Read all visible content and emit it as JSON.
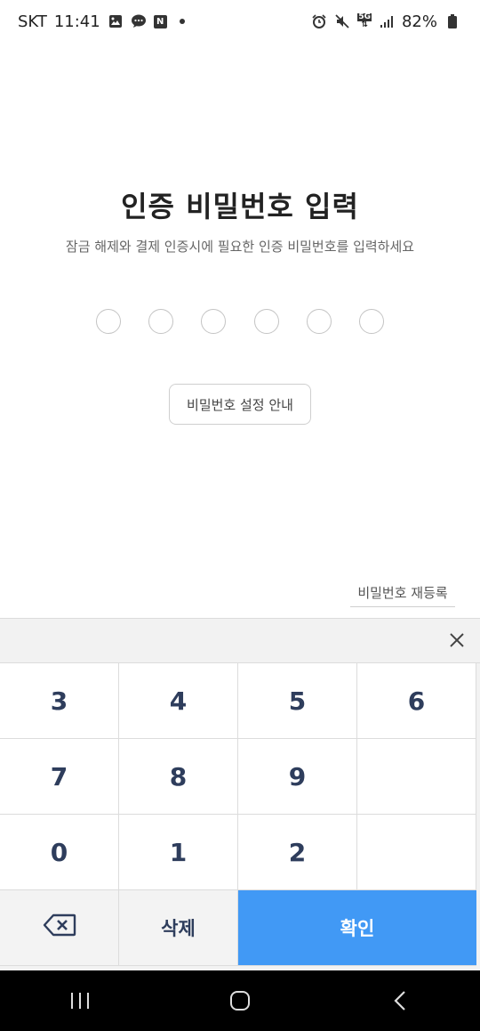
{
  "status_bar": {
    "carrier": "SKT",
    "time": "11:41",
    "network": "5G",
    "battery": "82%"
  },
  "screen": {
    "title": "인증 비밀번호 입력",
    "subtitle": "잠금 해제와 결제 인증시에 필요한 인증 비밀번호를 입력하세요",
    "pin_length": 6,
    "pin_filled": 0,
    "guide_button": "비밀번호 설정 안내",
    "reregister_link": "비밀번호 재등록"
  },
  "keypad": {
    "rows": [
      [
        "3",
        "4",
        "5",
        "6"
      ],
      [
        "7",
        "8",
        "9",
        ""
      ],
      [
        "0",
        "1",
        "2",
        ""
      ]
    ],
    "delete_label": "삭제",
    "confirm_label": "확인",
    "confirm_color": "#4199f5"
  },
  "icons": {
    "status": [
      "gallery-icon",
      "chat-icon",
      "naver-icon",
      "alarm-icon",
      "mute-icon",
      "signal-icon",
      "battery-icon"
    ],
    "keypad_close": "close-icon",
    "backspace": "backspace-icon",
    "nav": [
      "recent-apps-icon",
      "home-icon",
      "back-icon"
    ]
  }
}
